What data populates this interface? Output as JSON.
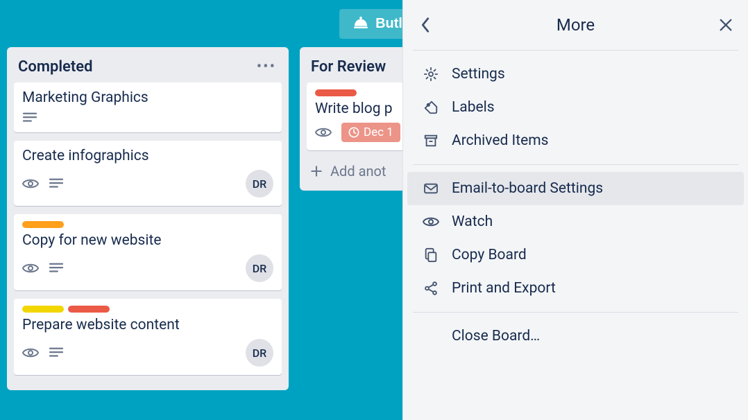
{
  "topbar": {
    "butler_label": "Butler"
  },
  "lists": {
    "completed": {
      "title": "Completed",
      "cards": [
        {
          "title": "Marketing Graphics",
          "labels": [],
          "has_watch": false,
          "has_description": true,
          "date": null,
          "member": null
        },
        {
          "title": "Create infographics",
          "labels": [],
          "has_watch": true,
          "has_description": true,
          "date": null,
          "member": "DR"
        },
        {
          "title": "Copy for new website",
          "labels": [
            "orange"
          ],
          "has_watch": true,
          "has_description": true,
          "date": null,
          "member": "DR"
        },
        {
          "title": "Prepare website content",
          "labels": [
            "yellow",
            "red"
          ],
          "has_watch": true,
          "has_description": true,
          "date": null,
          "member": "DR"
        }
      ]
    },
    "for_review": {
      "title": "For Review",
      "cards": [
        {
          "title": "Write blog p",
          "labels": [
            "red"
          ],
          "has_watch": true,
          "has_description": false,
          "date": "Dec 1",
          "member": null
        }
      ],
      "add_label": "Add anot"
    }
  },
  "panel": {
    "title": "More",
    "section1": {
      "settings": "Settings",
      "labels": "Labels",
      "archived": "Archived Items"
    },
    "section2": {
      "email": "Email-to-board Settings",
      "watch": "Watch",
      "copy": "Copy Board",
      "print": "Print and Export"
    },
    "section3": {
      "close": "Close Board…"
    }
  }
}
